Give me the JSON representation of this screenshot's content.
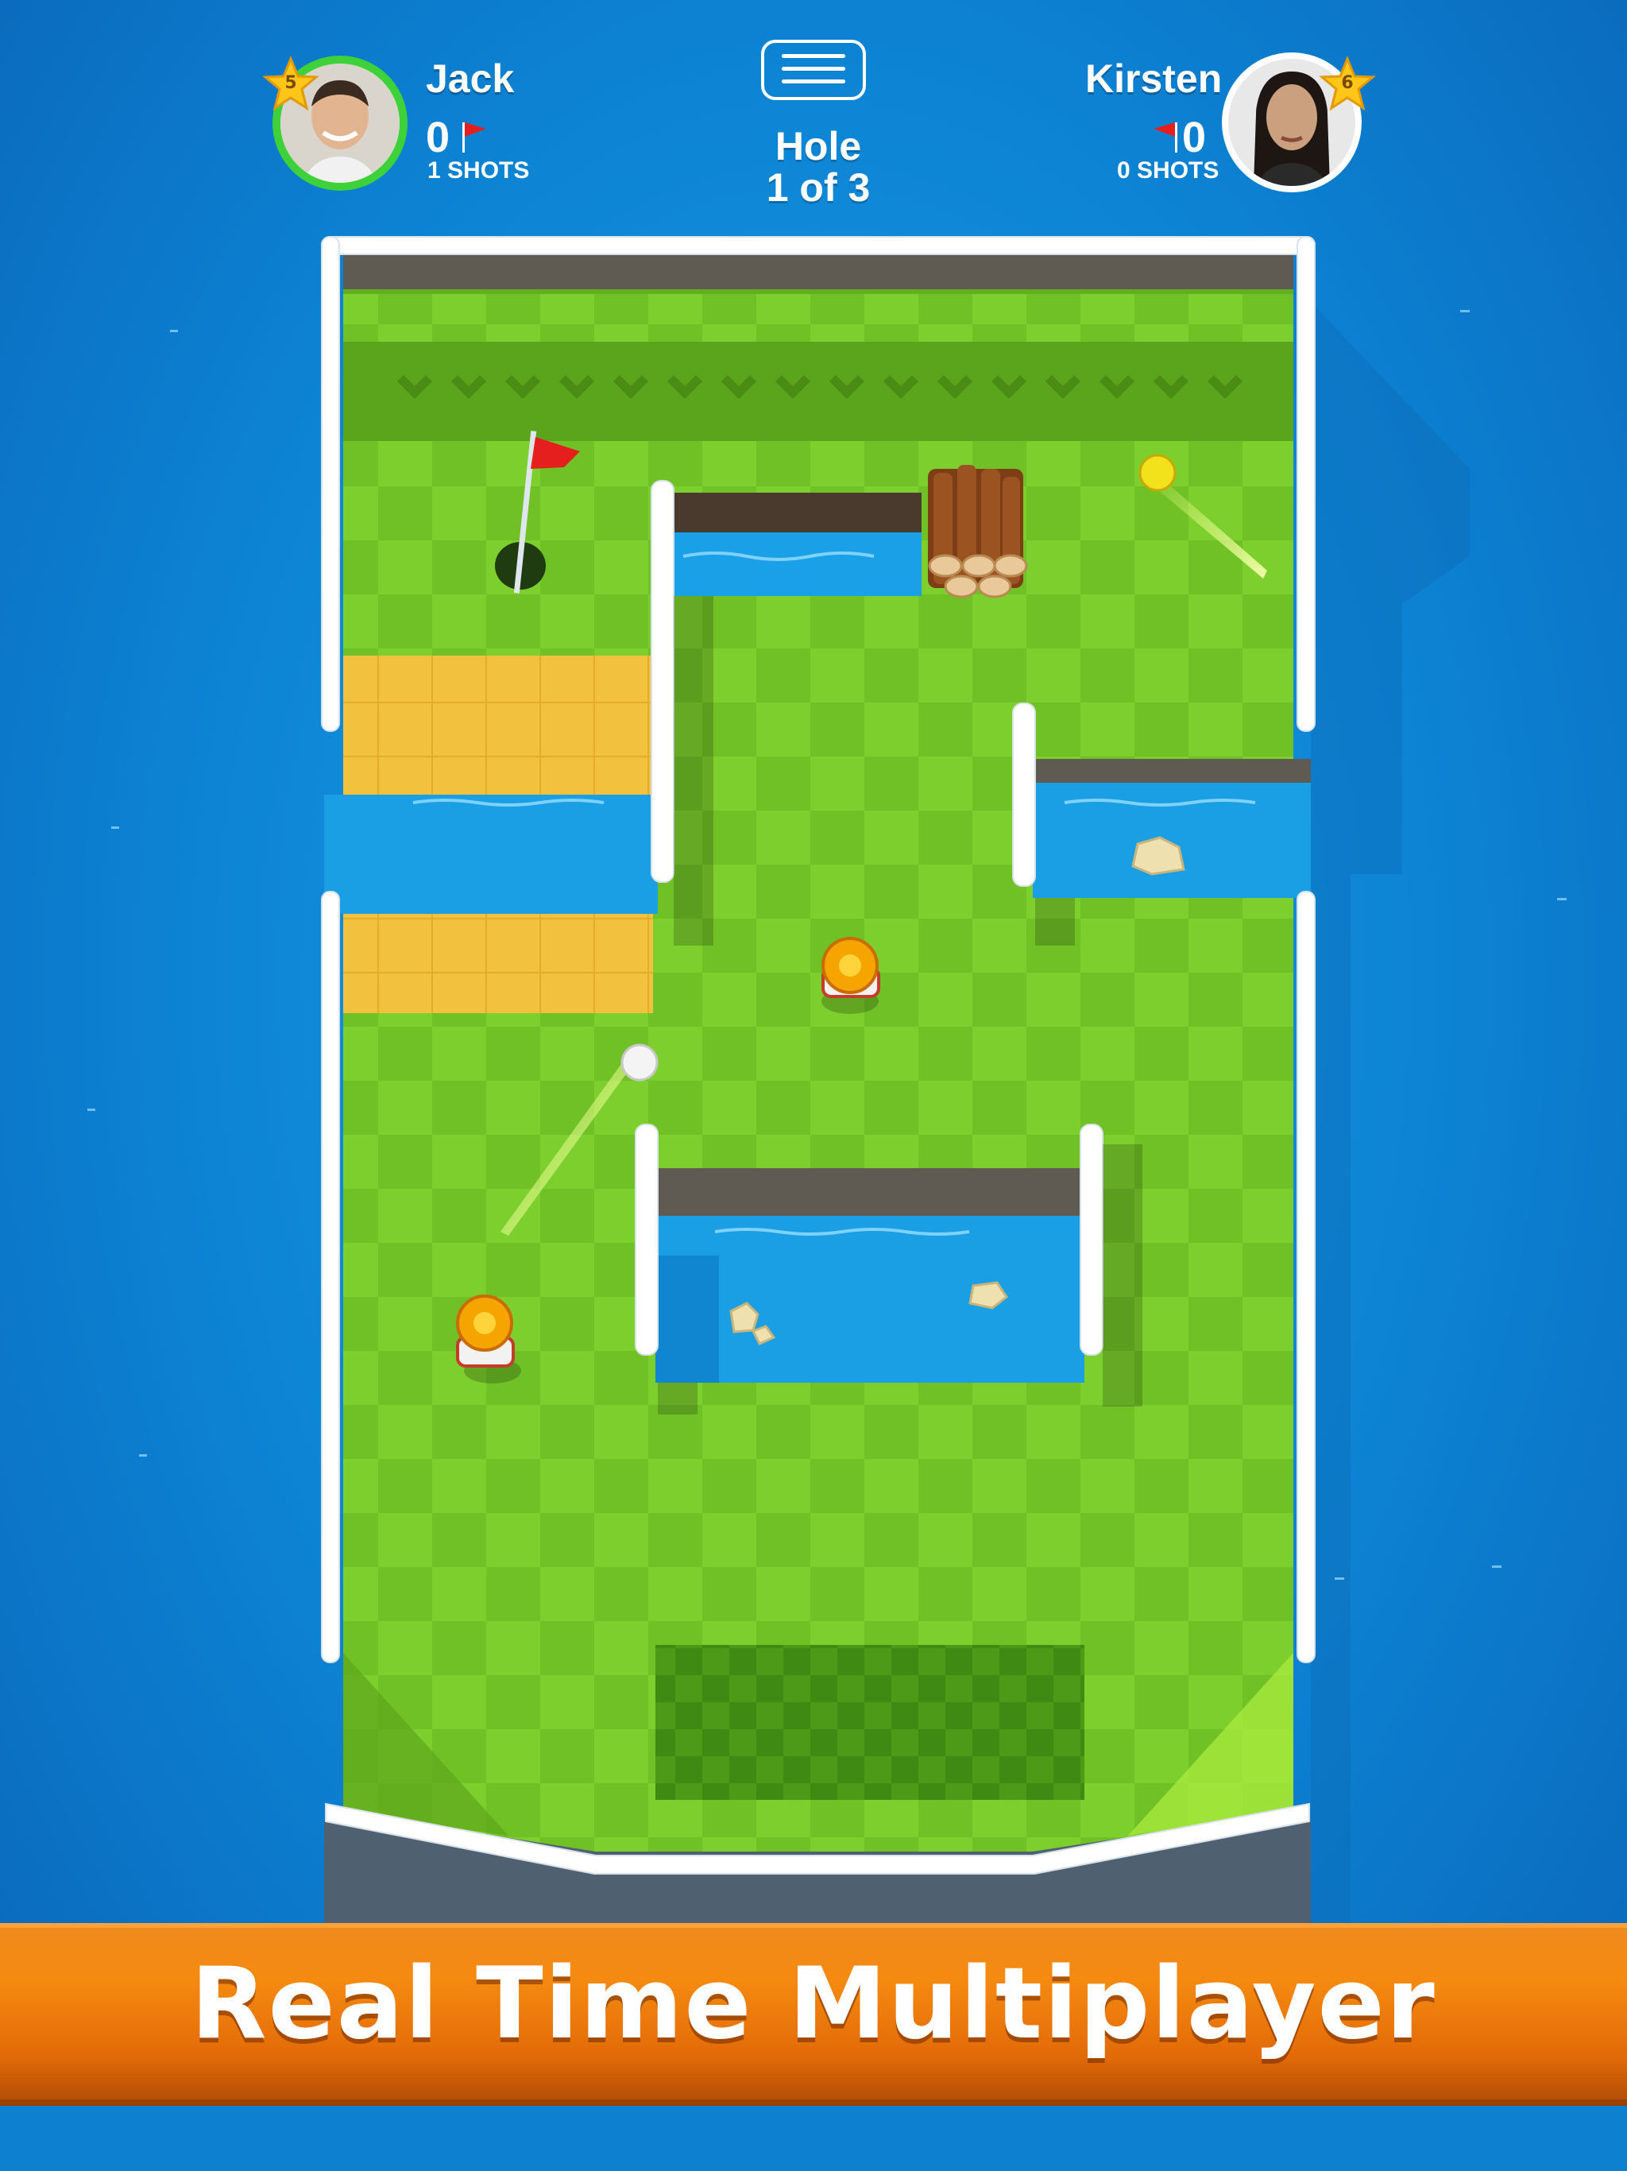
{
  "hud": {
    "player_left": {
      "name": "Jack",
      "level": "5",
      "score": "0",
      "shots": "1 SHOTS"
    },
    "player_right": {
      "name": "Kirsten",
      "level": "6",
      "score": "0",
      "shots": "0 SHOTS"
    },
    "hole_label": "Hole",
    "hole_progress": "1 of 3"
  },
  "banner": {
    "title": "Real Time Multiplayer"
  },
  "colors": {
    "accent_green": "#3fd13a",
    "banner_orange": "#f58a10",
    "water_blue": "#0d83d4"
  }
}
